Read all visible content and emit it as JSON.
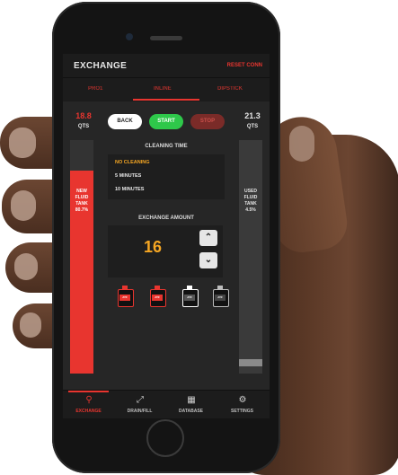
{
  "header": {
    "title": "EXCHANGE",
    "reset": "RESET CONN"
  },
  "tabs": [
    {
      "label": "PRO1"
    },
    {
      "label": "INLINE"
    },
    {
      "label": "DIPSTICK"
    }
  ],
  "left_tank": {
    "qty": "18.8",
    "unit": "QTS",
    "label_lines": [
      "NEW",
      "FLUID",
      "TANK",
      "80.7%"
    ],
    "level": 0.87
  },
  "right_tank": {
    "qty": "21.3",
    "unit": "QTS",
    "label_lines": [
      "USED",
      "FLUID",
      "TANK",
      "4.5%"
    ],
    "level": 0.045
  },
  "controls": {
    "back": "BACK",
    "start": "START",
    "stop": "STOP"
  },
  "cleaning": {
    "title": "CLEANING TIME",
    "options": [
      "NO CLEANING",
      "5 MINUTES",
      "10 MINUTES"
    ],
    "selected_index": 0
  },
  "exchange": {
    "title": "EXCHANGE AMOUNT",
    "value": "16"
  },
  "bottles": [
    {
      "type": "ATF",
      "color": "#e8352f"
    },
    {
      "type": "ATF",
      "color": "#e8352f"
    },
    {
      "type": "ATF",
      "color": "#ffffff"
    },
    {
      "type": "ATF",
      "color": "#bdbdbd"
    }
  ],
  "nav": [
    {
      "label": "EXCHANGE",
      "icon": "location-pin-icon",
      "active": true
    },
    {
      "label": "DRAIN/FILL",
      "icon": "expand-arrows-icon",
      "active": false
    },
    {
      "label": "DATABASE",
      "icon": "database-icon",
      "active": false
    },
    {
      "label": "SETTINGS",
      "icon": "gear-icon",
      "active": false
    }
  ],
  "colors": {
    "accent": "#e8352f",
    "start": "#2ec84a",
    "value": "#f5a623"
  }
}
